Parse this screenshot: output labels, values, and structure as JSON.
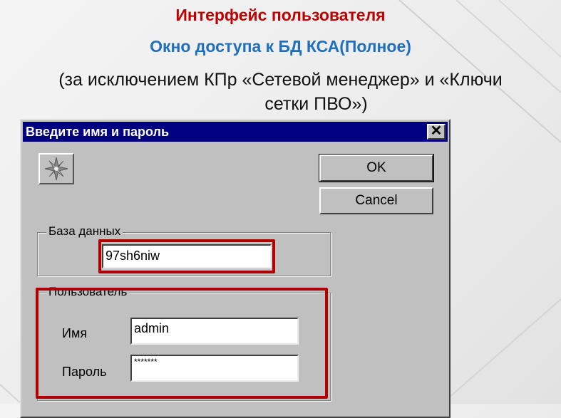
{
  "slide": {
    "title": "Интерфейс пользователя",
    "subtitle": "Окно доступа к БД КСА(Полное)",
    "note_line1": "(за исключением КПр «Сетевой менеджер»  и   «Ключи",
    "note_line2": "сетки ПВО»)"
  },
  "colors": {
    "title": "#c00000",
    "subtitle": "#1f6fbf",
    "titlebar": "#000080",
    "highlight": "#b00000"
  },
  "dialog": {
    "title": "Введите имя и пароль",
    "close_icon": "close-icon",
    "app_icon": "compass-star-icon",
    "ok_label": "OK",
    "cancel_label": "Cancel",
    "database": {
      "legend": "База данных",
      "value": "97sh6niw"
    },
    "user": {
      "legend": "Пользователь",
      "login_label": "Имя",
      "login_value": "admin",
      "password_label": "Пароль",
      "password_value": "*******"
    }
  }
}
